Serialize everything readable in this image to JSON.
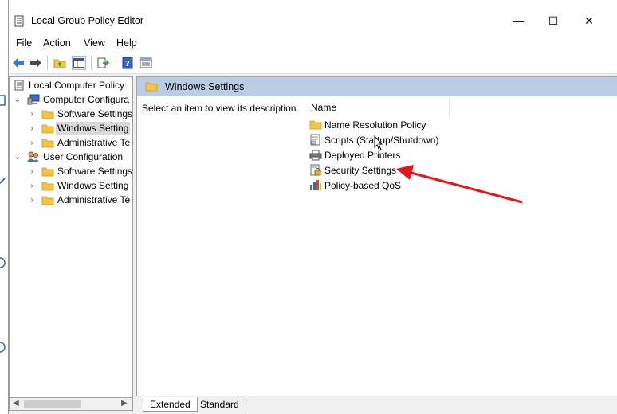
{
  "window": {
    "title": "Local Group Policy Editor",
    "controls": {
      "minimize": "—",
      "maximize": "☐",
      "close": "✕"
    }
  },
  "menu": [
    "File",
    "Action",
    "View",
    "Help"
  ],
  "toolbar": [
    "back-icon",
    "forward-icon",
    "up-folder-icon",
    "show-hide-tree-icon",
    "export-list-icon",
    "help-icon",
    "properties-icon"
  ],
  "tree": {
    "root": "Local Computer Policy",
    "computer_config": "Computer Configura",
    "computer_children": [
      "Software Settings",
      "Windows Setting",
      "Administrative Te"
    ],
    "user_config": "User Configuration",
    "user_children": [
      "Software Settings",
      "Windows Setting",
      "Administrative Te"
    ]
  },
  "content": {
    "header": "Windows Settings",
    "description": "Select an item to view its description.",
    "column_name": "Name",
    "items": [
      "Name Resolution Policy",
      "Scripts (Startup/Shutdown)",
      "Deployed Printers",
      "Security Settings",
      "Policy-based QoS"
    ]
  },
  "tabs": [
    "Extended",
    "Standard"
  ],
  "colors": {
    "header_bg": "#b9cde4",
    "annotation_arrow": "#e8141c",
    "folder": "#f5c542"
  }
}
